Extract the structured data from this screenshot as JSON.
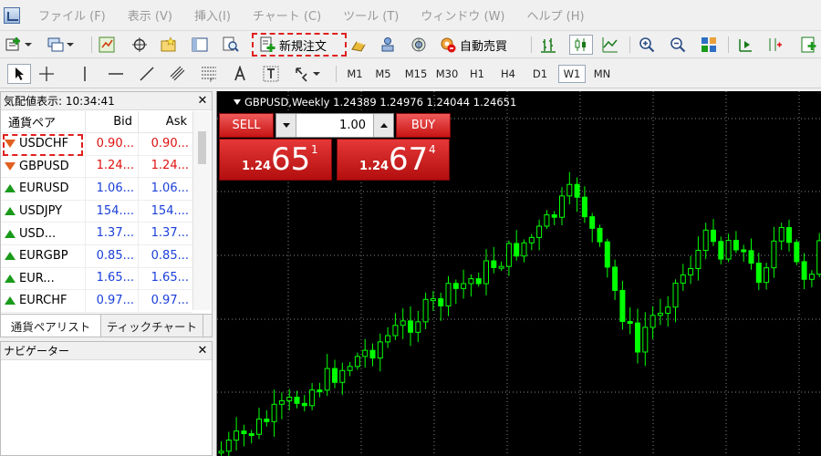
{
  "menu": {
    "items": [
      "ファイル (F)",
      "表示 (V)",
      "挿入(I)",
      "チャート (C)",
      "ツール (T)",
      "ウィンドウ (W)",
      "ヘルプ (H)"
    ]
  },
  "toolbar": {
    "new_order_label": "新規注文",
    "auto_trade_label": "自動売買"
  },
  "timeframes": [
    "M1",
    "M5",
    "M15",
    "M30",
    "H1",
    "H4",
    "D1",
    "W1",
    "MN"
  ],
  "active_timeframe": "W1",
  "market_watch": {
    "title": "気配値表示: 10:34:41",
    "columns": [
      "通貨ペア",
      "Bid",
      "Ask"
    ],
    "rows": [
      {
        "symbol": "USDCHF",
        "bid": "0.90...",
        "ask": "0.90...",
        "direction": "down",
        "color": "red"
      },
      {
        "symbol": "GBPUSD",
        "bid": "1.24...",
        "ask": "1.24...",
        "direction": "down",
        "color": "red"
      },
      {
        "symbol": "EURUSD",
        "bid": "1.06...",
        "ask": "1.06...",
        "direction": "up",
        "color": "blue"
      },
      {
        "symbol": "USDJPY",
        "bid": "154....",
        "ask": "154....",
        "direction": "up",
        "color": "blue"
      },
      {
        "symbol": "USD...",
        "bid": "1.37...",
        "ask": "1.37...",
        "direction": "up",
        "color": "blue"
      },
      {
        "symbol": "EURGBP",
        "bid": "0.85...",
        "ask": "0.85...",
        "direction": "up",
        "color": "blue"
      },
      {
        "symbol": "EUR...",
        "bid": "1.65...",
        "ask": "1.65...",
        "direction": "up",
        "color": "blue"
      },
      {
        "symbol": "EURCHF",
        "bid": "0.97...",
        "ask": "0.97...",
        "direction": "up",
        "color": "blue"
      }
    ],
    "tabs": [
      "通貨ペアリスト",
      "ティックチャート"
    ]
  },
  "navigator": {
    "title": "ナビゲーター"
  },
  "chart": {
    "caption": "GBPUSD,Weekly  1.24389 1.24976 1.24044 1.24651",
    "candle_color": "#00ff00",
    "grid_color": "#888888",
    "one_click": {
      "sell_label": "SELL",
      "buy_label": "BUY",
      "lot": "1.00",
      "sell_prefix": "1.24",
      "sell_big": "65",
      "sell_sup": "1",
      "buy_prefix": "1.24",
      "buy_big": "67",
      "buy_sup": "4"
    }
  },
  "colors": {
    "highlight": "#e02020",
    "bid_down": "#e01010",
    "bid_up": "#1a3fd9"
  }
}
